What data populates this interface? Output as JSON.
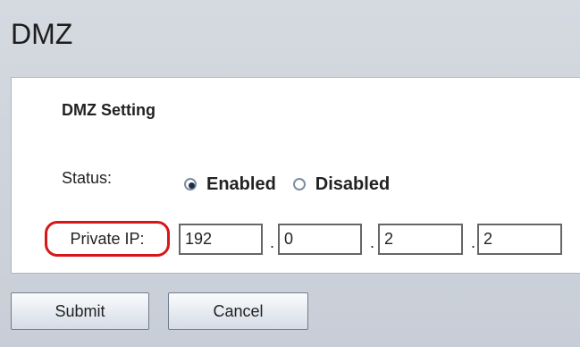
{
  "page": {
    "title": "DMZ"
  },
  "dmz_setting": {
    "section_title": "DMZ Setting",
    "status_label": "Status:",
    "status_options": [
      {
        "label": "Enabled",
        "selected": true
      },
      {
        "label": "Disabled",
        "selected": false
      }
    ],
    "private_ip_label": "Private IP:",
    "private_ip_octets": [
      "192",
      "0",
      "2",
      "2"
    ],
    "dot": "."
  },
  "buttons": {
    "submit": "Submit",
    "cancel": "Cancel"
  },
  "colors": {
    "highlight": "#d71717",
    "radio_fill": "#1f2f45",
    "panel_background": "#ffffff"
  }
}
